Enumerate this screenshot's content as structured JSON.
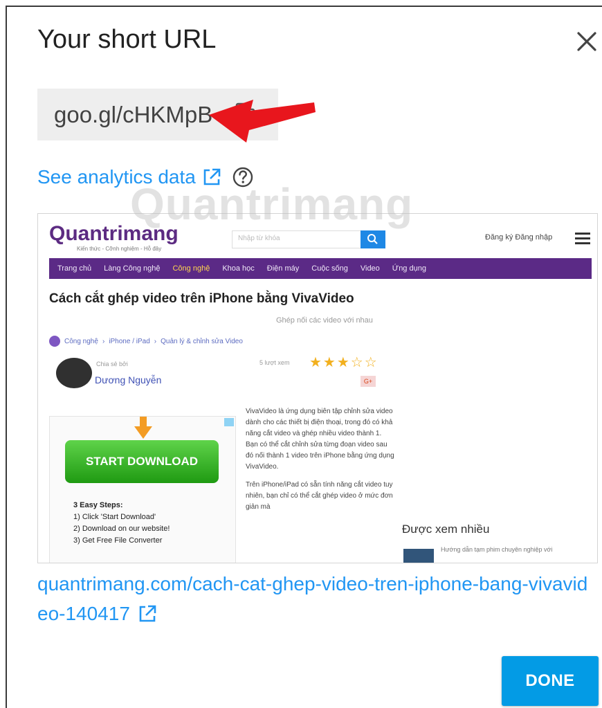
{
  "dialog": {
    "title": "Your short URL",
    "close_icon": "close-icon",
    "short_url": "goo.gl/cHKMpB",
    "copy_icon": "copy-icon",
    "analytics_link": "See analytics data",
    "analytics_icon": "external-link-icon",
    "help_icon": "help-icon",
    "long_url": "quantrimang.com/cach-cat-ghep-video-tren-iphone-bang-vivavideo-140417",
    "done_label": "DONE",
    "accent": "#039be5",
    "link_color": "#2196f3",
    "annotation_arrow_color": "#e8161d"
  },
  "preview": {
    "logo": "Quantrimang",
    "logo_sub": "Kiến thức - Cỡnh nghiệm - Hỗ đây",
    "search_placeholder": "Nhập từ khóa",
    "auth": "Đăng ký  Đăng nhập",
    "nav": [
      {
        "label": "Trang chủ"
      },
      {
        "label": "Làng Công nghệ"
      },
      {
        "label": "Công nghệ"
      },
      {
        "label": "Khoa học"
      },
      {
        "label": "Điện máy"
      },
      {
        "label": "Cuộc sống"
      },
      {
        "label": "Video"
      },
      {
        "label": "Ứng dụng"
      }
    ],
    "article_title": "Cách cắt ghép video trên iPhone bằng VivaVideo",
    "article_subtitle": "Ghép nối các video với nhau",
    "breadcrumb": [
      "Công nghệ",
      "iPhone / iPad",
      "Quản lý & chỉnh sửa Video"
    ],
    "author_tag": "Chia sẻ bởi",
    "author_name": "Dương Nguyễn",
    "views": "5 lượt xem",
    "rating": "★★★☆☆",
    "gplus": "G+",
    "ad_button": "START DOWNLOAD",
    "ad_steps_title": "3 Easy Steps:",
    "ad_steps": [
      "1) Click 'Start Download'",
      "2) Download on our website!",
      "3) Get Free File Converter"
    ],
    "body_p1": "VivaVideo là ứng dụng biên tập chỉnh sửa video dành cho các thiết bị điện thoại, trong đó có khả năng cắt video và ghép nhiều video thành 1. Bạn có thể cắt chỉnh sửa từng đoạn video sau đó nối thành 1 video trên iPhone bằng ứng dụng VivaVideo.",
    "body_p2": "Trên iPhone/iPad có sẵn tính năng cắt video tuy nhiên, bạn chỉ có thể cắt ghép video ở mức đơn giản mà",
    "popular_heading": "Được xem nhiều",
    "popular_item": "Hướng dẫn tạm phim chuyên nghiệp với",
    "watermark": "Quantrimang"
  }
}
